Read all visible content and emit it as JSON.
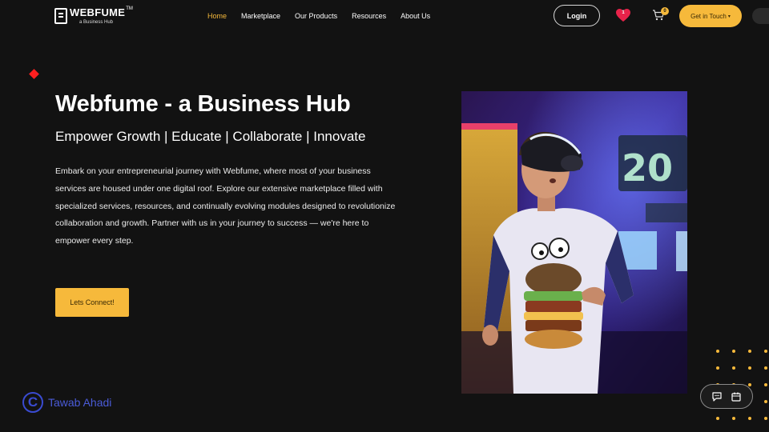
{
  "header": {
    "logo_main": "WEBFUME",
    "logo_tm": "TM",
    "logo_sub": "a Business Hub",
    "nav": [
      {
        "label": "Home",
        "active": true
      },
      {
        "label": "Marketplace",
        "active": false
      },
      {
        "label": "Our Products",
        "active": false
      },
      {
        "label": "Resources",
        "active": false
      },
      {
        "label": "About Us",
        "active": false
      }
    ],
    "login_label": "Login",
    "wishlist_count": "1",
    "cart_count": "0",
    "get_in_touch_label": "Get in Touch",
    "get_in_touch_caret": "▾"
  },
  "hero": {
    "title": "Webfume - a Business Hub",
    "subtitle": "Empower Growth | Educate | Collaborate | Innovate",
    "description": "Embark on your entrepreneurial journey with Webfume, where most of your business services are housed under one digital roof. Explore our extensive marketplace filled with specialized services, resources, and continually evolving modules designed to revolutionize collaboration and growth. Partner with us in your journey to success — we're here to empower every step.",
    "cta_label": "Lets Connect!"
  },
  "watermark": {
    "letter": "C",
    "text": "Tawab Ahadi"
  },
  "colors": {
    "accent": "#f6b93b",
    "background": "#121212",
    "heart": "#e8234a",
    "watermark": "#3a4bd1"
  },
  "icons": [
    "heart-icon",
    "cart-icon",
    "chat-icon",
    "calendar-icon",
    "red-diamond-icon"
  ]
}
